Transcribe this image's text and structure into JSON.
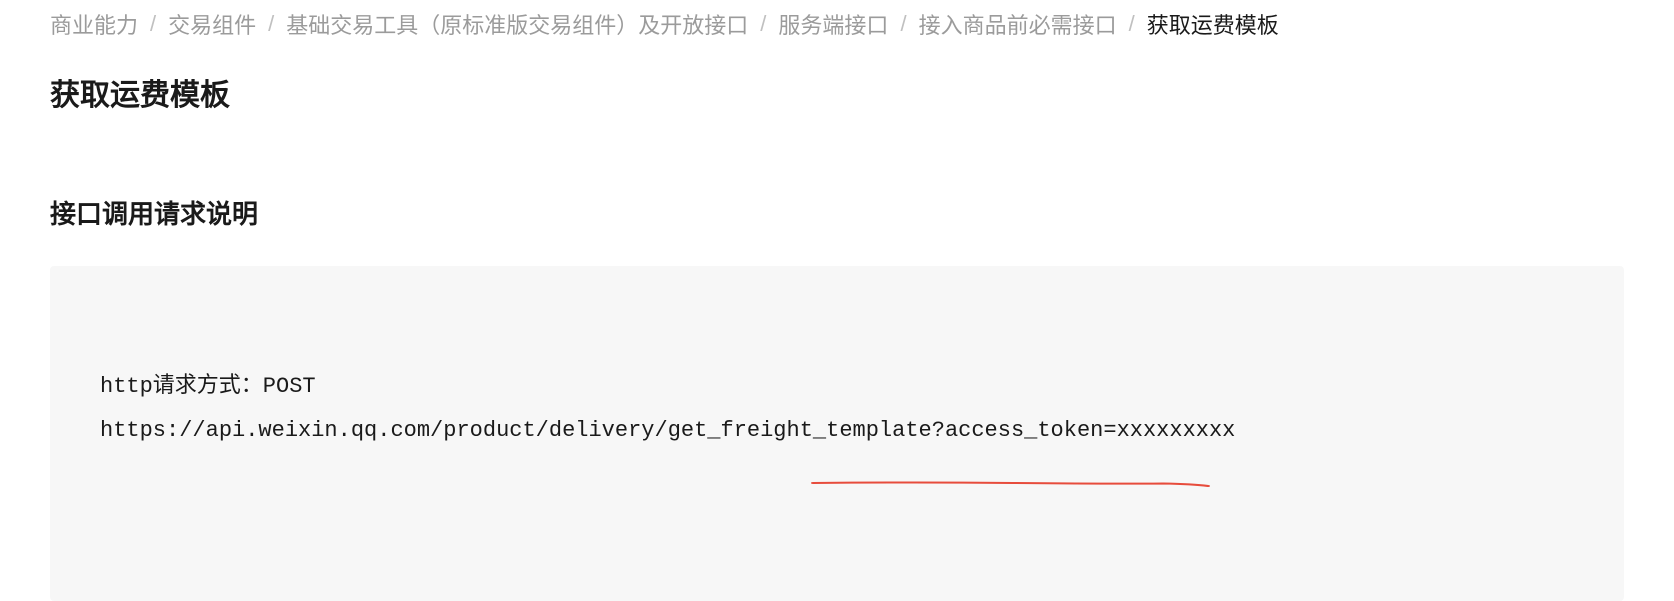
{
  "breadcrumb": {
    "items": [
      {
        "label": "商业能力"
      },
      {
        "label": "交易组件"
      },
      {
        "label": "基础交易工具（原标准版交易组件）及开放接口"
      },
      {
        "label": "服务端接口"
      },
      {
        "label": "接入商品前必需接口"
      },
      {
        "label": "获取运费模板"
      }
    ]
  },
  "page": {
    "title": "获取运费模板"
  },
  "section": {
    "title": "接口调用请求说明"
  },
  "code": {
    "line1": "http请求方式：POST",
    "line2": "https://api.weixin.qq.com/product/delivery/get_freight_template?access_token=xxxxxxxxx"
  }
}
